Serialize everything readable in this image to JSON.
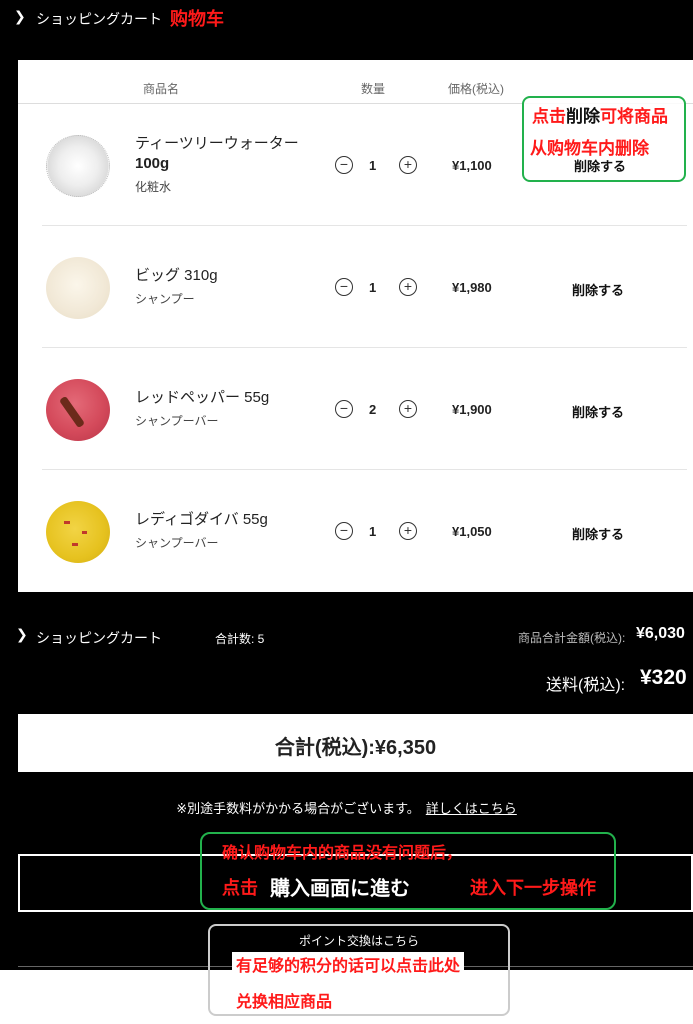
{
  "header": {
    "title": "ショッピングカート",
    "annotation": "购物车"
  },
  "cart": {
    "columns": {
      "name": "商品名",
      "qty": "数量",
      "price": "価格(税込)"
    },
    "items": [
      {
        "name_line1": "ティーツリーウォーター",
        "name_line2": "100g",
        "category": "化粧水",
        "qty": "1",
        "price": "¥1,100",
        "delete": "削除する",
        "color": "#f2f2f2"
      },
      {
        "name_line1": "ビッグ 310g",
        "name_line2": "",
        "category": "シャンプー",
        "qty": "1",
        "price": "¥1,980",
        "delete": "削除する",
        "color": "#f3ece0"
      },
      {
        "name_line1": "レッドペッパー 55g",
        "name_line2": "",
        "category": "シャンプーバー",
        "qty": "2",
        "price": "¥1,900",
        "delete": "削除する",
        "color": "#d9475a"
      },
      {
        "name_line1": "レディゴダイバ 55g",
        "name_line2": "",
        "category": "シャンプーバー",
        "qty": "1",
        "price": "¥1,050",
        "delete": "削除する",
        "color": "#e8c21e"
      }
    ],
    "minus_symbol": "−",
    "plus_symbol": "+"
  },
  "annotation_delete": {
    "part1": "点击",
    "part2": "削除",
    "part3": "可将商品",
    "line2": "从购物车内删除"
  },
  "summary": {
    "title": "ショッピングカート",
    "count": "合計数: 5",
    "subtotal_label": "商品合計金額(税込):",
    "subtotal_value": "¥6,030",
    "shipping_label": "送料(税込):",
    "shipping_value": "¥320",
    "total": "合計(税込):¥6,350"
  },
  "note": {
    "text": "※別途手数料がかかる場合がございます。",
    "link": "詳しくはこちら"
  },
  "buy": {
    "label": "購入画面に進む",
    "annotation_top": "确认购物车内的商品没有问题后，",
    "annotation_click": "点击",
    "annotation_next": "进入下一步操作"
  },
  "points": {
    "label": "ポイント交換はこちら",
    "annotation_line1": "有足够的积分的话可以点击此处",
    "annotation_line2": "兑换相应商品"
  },
  "colors": {
    "annotation_red": "#ff1a1a",
    "annotation_green": "#22b14c"
  }
}
